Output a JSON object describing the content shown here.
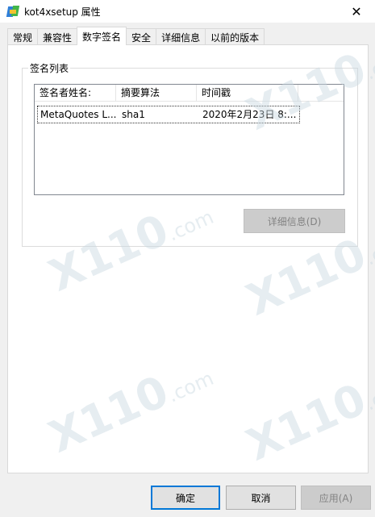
{
  "window": {
    "title": "kot4xsetup 属性",
    "close_glyph": "✕"
  },
  "tabs": [
    {
      "label": "常规",
      "active": false
    },
    {
      "label": "兼容性",
      "active": false
    },
    {
      "label": "数字签名",
      "active": true
    },
    {
      "label": "安全",
      "active": false
    },
    {
      "label": "详细信息",
      "active": false
    },
    {
      "label": "以前的版本",
      "active": false
    }
  ],
  "signature_group": {
    "label": "签名列表",
    "columns": [
      "签名者姓名:",
      "摘要算法",
      "时间戳"
    ],
    "rows": [
      {
        "signer": "MetaQuotes L...",
        "digest": "sha1",
        "timestamp": "2020年2月23日 8:..."
      }
    ],
    "details_button": "详细信息(D)"
  },
  "footer": {
    "ok": "确定",
    "cancel": "取消",
    "apply": "应用(A)"
  },
  "watermark": {
    "brand": "X110",
    "domain": ".com"
  },
  "colors": {
    "accent": "#0078d7",
    "window_bg": "#f0f0f0",
    "panel_bg": "#ffffff"
  }
}
